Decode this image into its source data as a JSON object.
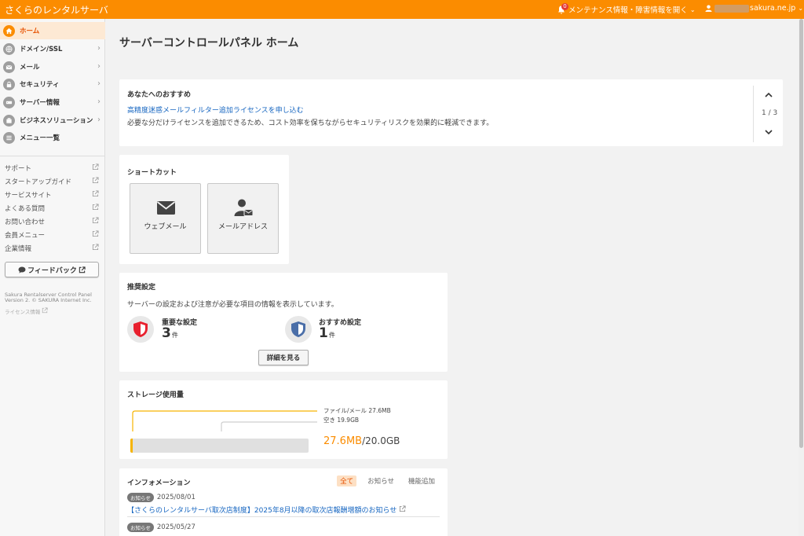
{
  "topbar": {
    "brand": "さくらのレンタルサーバ",
    "notification_count": "0",
    "maintenance_label": "メンテナンス情報・障害情報を開く",
    "user_domain": "sakura.ne.jp",
    "brand_color": "#fb8c00"
  },
  "sidebar": {
    "items": [
      {
        "label": "ホーム",
        "icon": "home-icon",
        "active": true
      },
      {
        "label": "ドメイン/SSL",
        "icon": "globe-icon"
      },
      {
        "label": "メール",
        "icon": "mail-icon"
      },
      {
        "label": "セキュリティ",
        "icon": "lock-icon"
      },
      {
        "label": "サーバー情報",
        "icon": "server-icon"
      },
      {
        "label": "ビジネスソリューション",
        "icon": "briefcase-icon"
      },
      {
        "label": "メニュー一覧",
        "icon": "list-icon"
      }
    ],
    "links": [
      "サポート",
      "スタートアップガイド",
      "サービスサイト",
      "よくある質問",
      "お問い合わせ",
      "会員メニュー",
      "企業情報"
    ],
    "feedback": "フィードバック",
    "copyright_1": "Sakura Rentalserver Control Panel",
    "copyright_2": "Version 2. © SAKURA Internet Inc.",
    "license": "ライセンス情報"
  },
  "main": {
    "title": "サーバーコントロールパネル ホーム",
    "recommend": {
      "title": "あなたへのおすすめ",
      "link": "高精度迷惑メールフィルター追加ライセンスを申し込む",
      "desc": "必要な分だけライセンスを追加できるため、コスト効率を保ちながらセキュリティリスクを効果的に軽減できます。",
      "page": "1 / 3"
    },
    "shortcut": {
      "title": "ショートカット",
      "webmail": "ウェブメール",
      "mail_address": "メールアドレス"
    },
    "settings": {
      "title": "推奨設定",
      "desc": "サーバーの設定および注意が必要な項目の情報を表示しています。",
      "important_label": "重要な設定",
      "important_count": "3",
      "recommend_label": "おすすめ設定",
      "recommend_count": "1",
      "unit": "件",
      "detail_button": "詳細を見る"
    },
    "storage": {
      "title": "ストレージ使用量",
      "legend_used": "ファイル/メール 27.6MB",
      "legend_free": "空き 19.9GB",
      "used": "27.6MB",
      "total": "/20.0GB",
      "used_fraction": 0.0014
    },
    "info": {
      "title": "インフォメーション",
      "tabs": [
        "全て",
        "お知らせ",
        "機能追加"
      ],
      "items": [
        {
          "tag": "お知らせ",
          "date": "2025/08/01",
          "title": "【さくらのレンタルサーバ取次店制度】2025年8月以降の取次店報酬増額のお知らせ"
        },
        {
          "tag": "お知らせ",
          "date": "2025/05/27",
          "title": ""
        }
      ]
    }
  }
}
